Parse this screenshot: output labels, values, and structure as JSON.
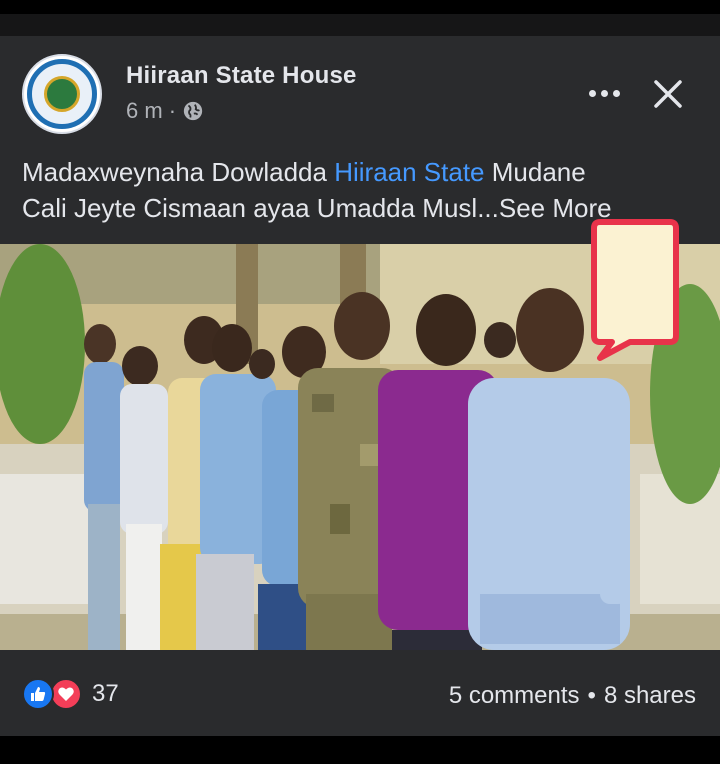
{
  "post": {
    "page_name": "Hiiraan State House",
    "time": "6 m",
    "meta_sep": "·",
    "privacy_icon": "globe-icon",
    "caption_part1": "Madaxweynaha Dowladda ",
    "caption_link": "Hiiraan State",
    "caption_part2": " Mudane",
    "caption_line2": "Cali Jeyte Cismaan ayaa Umadda Musl...See More"
  },
  "actions": {
    "more_icon": "more-horizontal-icon",
    "close_icon": "close-icon"
  },
  "footer": {
    "reaction_icons": [
      "like-icon",
      "love-icon"
    ],
    "reaction_count": "37",
    "comments": "5 comments",
    "stat_sep": "•",
    "shares": "8 shares"
  },
  "colors": {
    "background": "#1f1f20",
    "card": "#2a2b2d",
    "link": "#4599ff",
    "like": "#1877f2",
    "love": "#f33e58",
    "callout_border": "#e8334a",
    "callout_fill": "#fbf2d2"
  }
}
